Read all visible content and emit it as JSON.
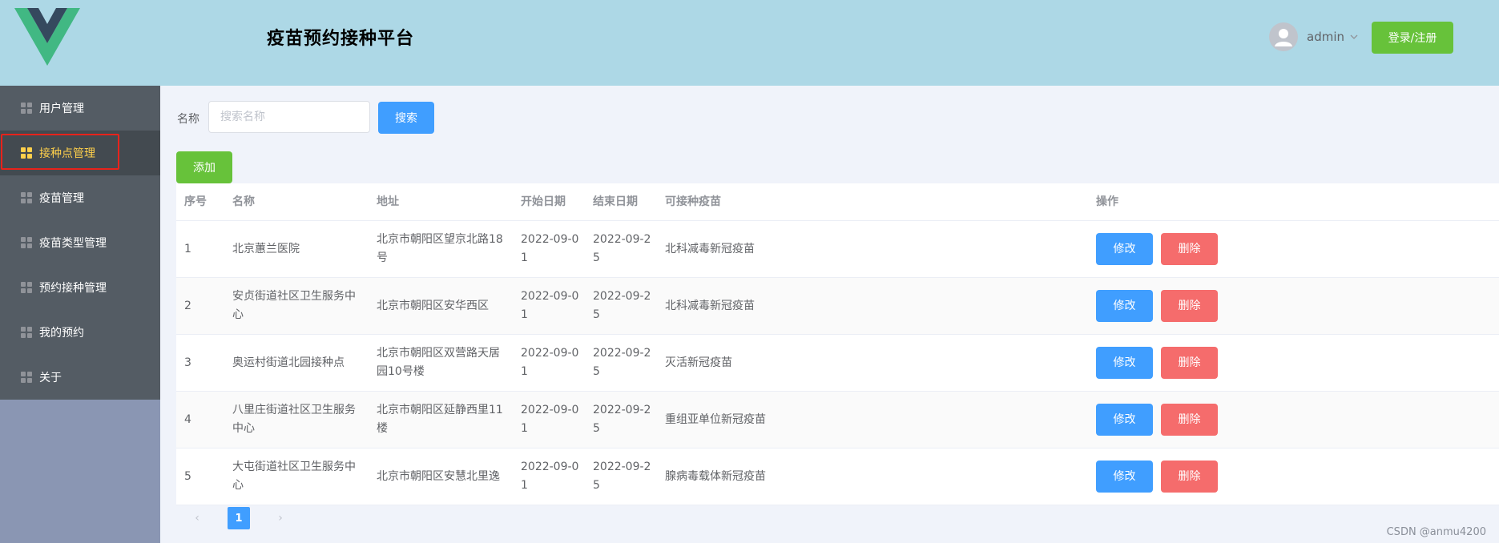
{
  "header": {
    "title": "疫苗预约接种平台",
    "username": "admin",
    "login_label": "登录/注册"
  },
  "sidebar": {
    "items": [
      {
        "label": "用户管理",
        "active": false
      },
      {
        "label": "接种点管理",
        "active": true
      },
      {
        "label": "疫苗管理",
        "active": false
      },
      {
        "label": "疫苗类型管理",
        "active": false
      },
      {
        "label": "预约接种管理",
        "active": false
      },
      {
        "label": "我的预约",
        "active": false
      },
      {
        "label": "关于",
        "active": false
      }
    ]
  },
  "search": {
    "label": "名称",
    "placeholder": "搜索名称",
    "value": "",
    "button_label": "搜索"
  },
  "toolbar": {
    "add_label": "添加"
  },
  "table": {
    "columns": [
      "序号",
      "名称",
      "地址",
      "开始日期",
      "结束日期",
      "可接种疫苗",
      "操作"
    ],
    "rows": [
      {
        "index": "1",
        "name": "北京蕙兰医院",
        "address": "北京市朝阳区望京北路18号",
        "start": "2022-09-01",
        "end": "2022-09-25",
        "vaccine": "北科减毒新冠疫苗"
      },
      {
        "index": "2",
        "name": "安贞街道社区卫生服务中心",
        "address": "北京市朝阳区安华西区",
        "start": "2022-09-01",
        "end": "2022-09-25",
        "vaccine": "北科减毒新冠疫苗"
      },
      {
        "index": "3",
        "name": "奥运村街道北园接种点",
        "address": "北京市朝阳区双营路天居园10号楼",
        "start": "2022-09-01",
        "end": "2022-09-25",
        "vaccine": "灭活新冠疫苗"
      },
      {
        "index": "4",
        "name": "八里庄街道社区卫生服务中心",
        "address": "北京市朝阳区延静西里11楼",
        "start": "2022-09-01",
        "end": "2022-09-25",
        "vaccine": "重组亚单位新冠疫苗"
      },
      {
        "index": "5",
        "name": "大屯街道社区卫生服务中心",
        "address": "北京市朝阳区安慧北里逸",
        "start": "2022-09-01",
        "end": "2022-09-25",
        "vaccine": "腺病毒载体新冠疫苗"
      }
    ],
    "edit_label": "修改",
    "delete_label": "删除"
  },
  "pagination": {
    "current": "1",
    "prev": "‹",
    "next": "›"
  },
  "watermark": "CSDN @anmu4200",
  "colors": {
    "header_bg": "#add8e6",
    "sidebar_bg": "#545c64",
    "sidebar_active_text": "#ffd04b",
    "primary": "#409eff",
    "success": "#67c23a",
    "danger": "#f56c6c"
  }
}
